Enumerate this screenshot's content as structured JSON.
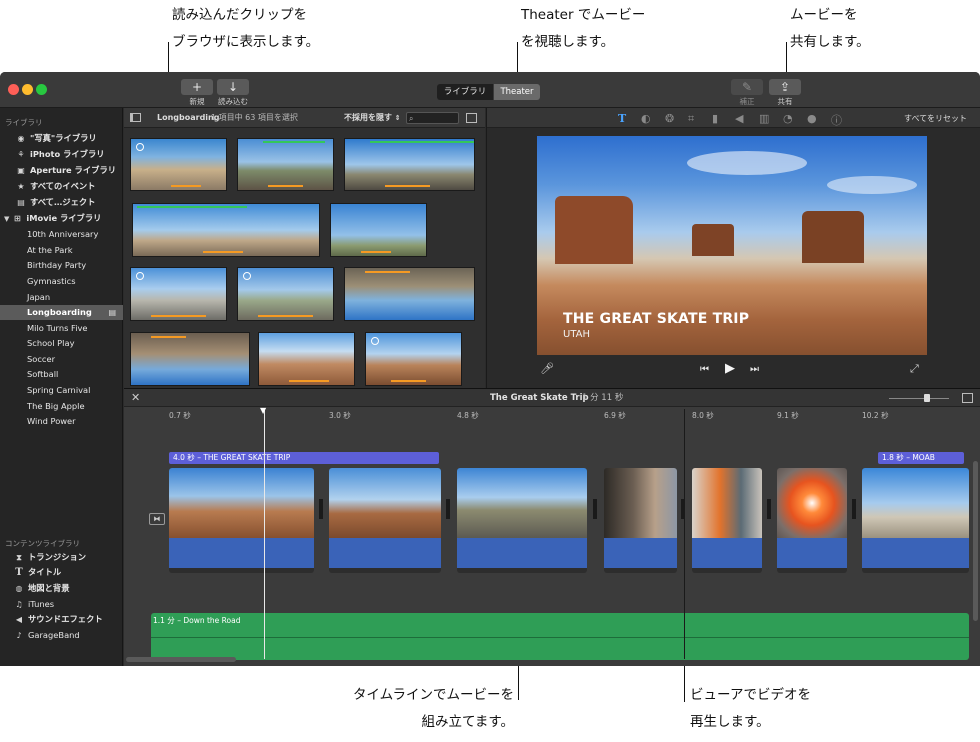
{
  "callouts": {
    "browser_1": "読み込んだクリップを",
    "browser_2": "ブラウザに表示します。",
    "theater_1": "Theater でムービー",
    "theater_2": "を視聴します。",
    "share_1": "ムービーを",
    "share_2": "共有します。",
    "timeline_1": "タイムラインでムービーを",
    "timeline_2": "組み立てます。",
    "viewer_1": "ビューアでビデオを",
    "viewer_2": "再生します。"
  },
  "toolbar": {
    "new_label": "新規",
    "import_label": "読み込む",
    "library_tab": "ライブラリ",
    "theater_tab": "Theater",
    "adjust_label": "補正",
    "share_label": "共有"
  },
  "sidebar": {
    "library_header": "ライブラリ",
    "items": [
      {
        "icon": "photos",
        "label": "\"写真\"ライブラリ"
      },
      {
        "icon": "iphoto",
        "label": "iPhoto ライブラリ"
      },
      {
        "icon": "aperture",
        "label": "Aperture ライブラリ"
      },
      {
        "icon": "star",
        "label": "すべてのイベント"
      },
      {
        "icon": "clapper",
        "label": "すべて…ジェクト"
      },
      {
        "icon": "grid",
        "label": "iMovie ライブラリ"
      }
    ],
    "events": [
      "10th Anniversary",
      "At the Park",
      "Birthday Party",
      "Gymnastics",
      "Japan",
      "Longboarding",
      "Milo Turns Five",
      "School Play",
      "Soccer",
      "Softball",
      "Spring Carnival",
      "The Big Apple",
      "Wind Power"
    ],
    "selected_event": "Longboarding",
    "content_header": "コンテンツライブラリ",
    "content_items": [
      {
        "icon": "transition",
        "label": "トランジション"
      },
      {
        "icon": "title",
        "label": "タイトル"
      },
      {
        "icon": "globe",
        "label": "地図と背景"
      },
      {
        "icon": "note",
        "label": "iTunes"
      },
      {
        "icon": "speaker",
        "label": "サウンドエフェクト"
      },
      {
        "icon": "guitar",
        "label": "GarageBand"
      }
    ]
  },
  "browser": {
    "event_name": "Longboarding",
    "selection_info": "1 項目中 63 項目を選択",
    "filter": "不採用を隠す"
  },
  "viewer": {
    "reset_label": "すべてをリセット",
    "title_main": "THE GREAT SKATE TRIP",
    "title_sub": "UTAH"
  },
  "timeline": {
    "project_name": "The Great Skate Trip",
    "duration": "1 分 11 秒",
    "ruler": [
      "0.7 秒",
      "3.0 秒",
      "4.8 秒",
      "6.9 秒",
      "8.0 秒",
      "9.1 秒",
      "10.2 秒"
    ],
    "title_clip_1": "4.0 秒 – THE GREAT SKATE TRIP",
    "title_clip_2": "1.8 秒 – MOAB",
    "music_clip": "1.1 分 – Down the Road"
  },
  "colors": {
    "title_purple": "#5d5fd8",
    "audio_blue": "#3a63b8",
    "music_green": "#2f9e56",
    "range_orange": "#f59a23",
    "favorite_green": "#34c759"
  }
}
